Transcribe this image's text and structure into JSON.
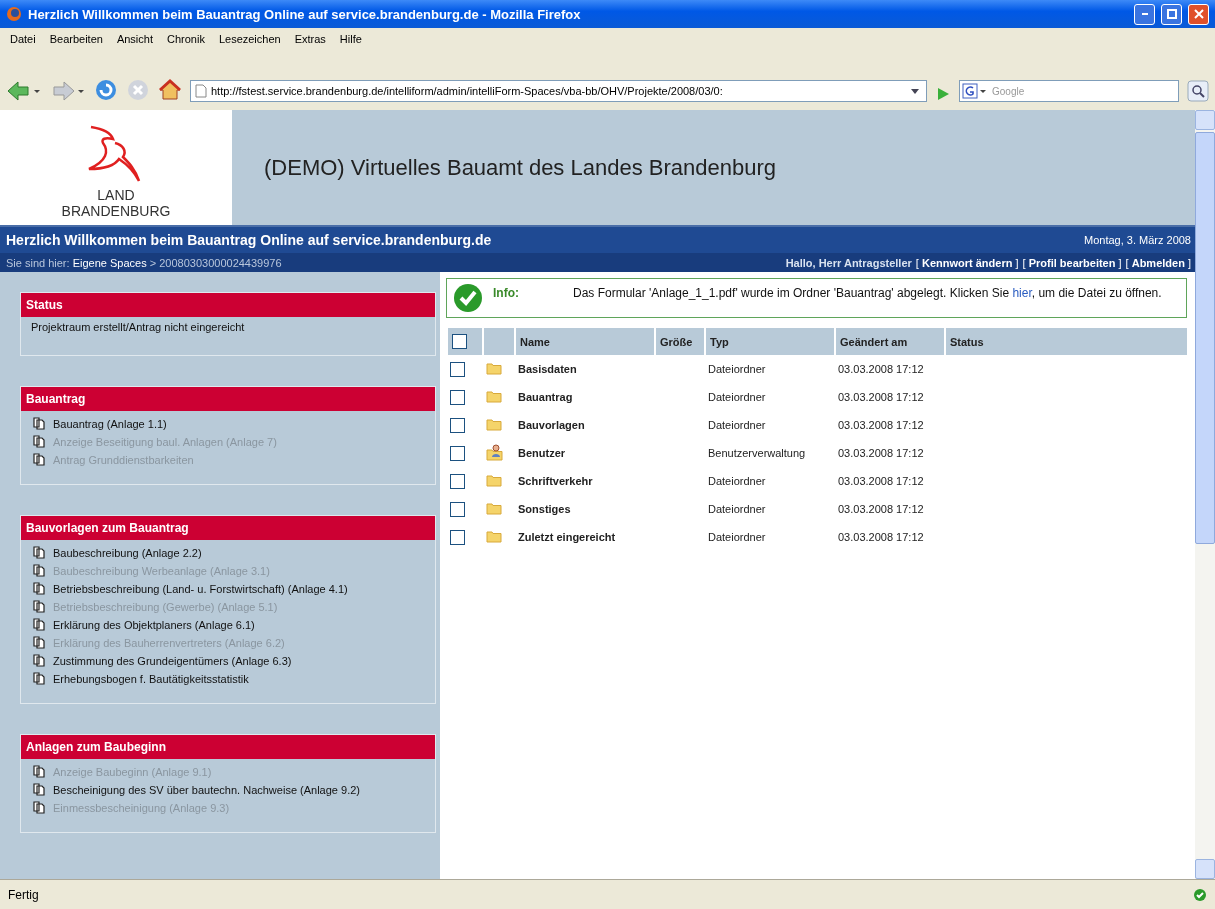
{
  "window": {
    "title": "Herzlich Willkommen beim Bauantrag Online auf service.brandenburg.de - Mozilla Firefox"
  },
  "menu": [
    "Datei",
    "Bearbeiten",
    "Ansicht",
    "Chronik",
    "Lesezeichen",
    "Extras",
    "Hilfe"
  ],
  "address_bar": {
    "value": "http://fstest.service.brandenburg.de/intelliform/admin/intelliForm-Spaces/vba-bb/OHV/Projekte/2008/03/0:"
  },
  "search": {
    "placeholder": "Google"
  },
  "header": {
    "logo_line_1": "LAND",
    "logo_line_2": "BRANDENBURG",
    "title": "(DEMO) Virtuelles Bauamt des Landes Brandenburg"
  },
  "welcome_bar": {
    "text": "Herzlich Willkommen beim Bauantrag Online auf service.brandenburg.de",
    "date": "Montag, 3. März 2008"
  },
  "breadcrumb": {
    "label": "Sie sind hier:",
    "link": "Eigene Spaces",
    "separator": ">",
    "current": "20080303000024439976"
  },
  "user": {
    "greeting": "Hallo, Herr Antragsteller",
    "links": [
      "[ **Kennwort ändern** ]",
      "[ **Profil bearbeiten** ]",
      "[ **Abmelden** ]"
    ]
  },
  "sidebar": [
    {
      "title": "Status",
      "kind": "text",
      "text": "Projektraum erstellt/Antrag nicht eingereicht"
    },
    {
      "title": "Bauantrag",
      "kind": "list",
      "items": [
        {
          "label": "Bauantrag (Anlage 1.1)",
          "disabled": false
        },
        {
          "label": "Anzeige Beseitigung baul. Anlagen (Anlage 7)",
          "disabled": true
        },
        {
          "label": "Antrag Grunddienstbarkeiten",
          "disabled": true
        }
      ]
    },
    {
      "title": "Bauvorlagen zum Bauantrag",
      "kind": "list",
      "items": [
        {
          "label": "Baubeschreibung (Anlage 2.2)",
          "disabled": false
        },
        {
          "label": "Baubeschreibung Werbeanlage (Anlage 3.1)",
          "disabled": true
        },
        {
          "label": "Betriebsbeschreibung (Land- u. Forstwirtschaft) (Anlage 4.1)",
          "disabled": false
        },
        {
          "label": "Betriebsbeschreibung (Gewerbe) (Anlage 5.1)",
          "disabled": true
        },
        {
          "label": "Erklärung des Objektplaners (Anlage 6.1)",
          "disabled": false
        },
        {
          "label": "Erklärung des Bauherrenvertreters (Anlage 6.2)",
          "disabled": true
        },
        {
          "label": "Zustimmung des Grundeigentümers (Anlage 6.3)",
          "disabled": false
        },
        {
          "label": "Erhebungsbogen f. Bautätigkeitsstatistik",
          "disabled": false
        }
      ]
    },
    {
      "title": "Anlagen zum Baubeginn",
      "kind": "list",
      "items": [
        {
          "label": "Anzeige Baubeginn (Anlage 9.1)",
          "disabled": true
        },
        {
          "label": "Bescheinigung des SV über bautechn. Nachweise (Anlage 9.2)",
          "disabled": false
        },
        {
          "label": "Einmessbescheinigung (Anlage 9.3)",
          "disabled": true
        }
      ]
    }
  ],
  "info": {
    "label": "Info:",
    "text_before": "Das Formular 'Anlage_1_1.pdf' wurde im Ordner 'Bauantrag' abgelegt. Klicken Sie ",
    "link": "hier",
    "text_after": ", um die Datei zu öffnen."
  },
  "table": {
    "select_all_checked": false,
    "columns": [
      "Name",
      "Größe",
      "Typ",
      "Geändert am",
      "Status"
    ],
    "rows": [
      {
        "kind": "folder",
        "name": "Basisdaten",
        "type": "Dateiordner",
        "modified": "03.03.2008 17:12",
        "checked": false
      },
      {
        "kind": "folder",
        "name": "Bauantrag",
        "type": "Dateiordner",
        "modified": "03.03.2008 17:12",
        "checked": false
      },
      {
        "kind": "folder",
        "name": "Bauvorlagen",
        "type": "Dateiordner",
        "modified": "03.03.2008 17:12",
        "checked": false
      },
      {
        "kind": "users",
        "name": "Benutzer",
        "type": "Benutzerverwaltung",
        "modified": "03.03.2008 17:12",
        "checked": false
      },
      {
        "kind": "folder",
        "name": "Schriftverkehr",
        "type": "Dateiordner",
        "modified": "03.03.2008 17:12",
        "checked": false
      },
      {
        "kind": "folder",
        "name": "Sonstiges",
        "type": "Dateiordner",
        "modified": "03.03.2008 17:12",
        "checked": false
      },
      {
        "kind": "folder",
        "name": "Zuletzt eingereicht",
        "type": "Dateiordner",
        "modified": "03.03.2008 17:12",
        "checked": false
      }
    ]
  },
  "status_bar": {
    "text": "Fertig"
  }
}
